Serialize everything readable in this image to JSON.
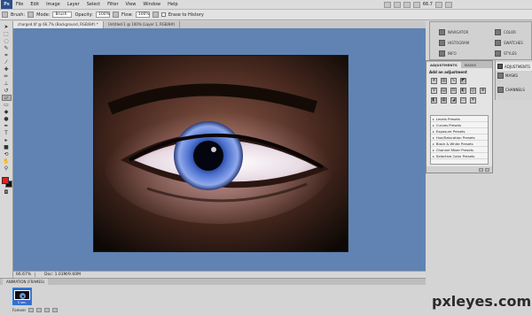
{
  "menubar": {
    "logo": "Ps",
    "items": [
      "File",
      "Edit",
      "Image",
      "Layer",
      "Select",
      "Filter",
      "View",
      "Window",
      "Help"
    ],
    "zoom": "66.7"
  },
  "options": {
    "brush_label": "Brush:",
    "mode_label": "Mode:",
    "mode_value": "Brush",
    "opacity_label": "Opacity:",
    "opacity_value": "100%",
    "flow_label": "Flow:",
    "flow_value": "100%",
    "erase_history_label": "Erase to History"
  },
  "doc_tabs": [
    "charged.tif @ 66.7% (Background, RGB/8#) *",
    "Untitled-1 @ 100% (Layer 1, RGB/8#)"
  ],
  "status": {
    "zoom": "66.67%",
    "doc": "Doc: 1.03M/9.60M"
  },
  "animation": {
    "title": "ANIMATION (FRAMES)",
    "frame_delay": "0 sec.",
    "loop": "Forever"
  },
  "dock_top": {
    "navigator": "NAVIGATOR",
    "histogram": "HISTOGRAM",
    "info": "INFO",
    "color": "COLOR",
    "swatches": "SWATCHES",
    "styles": "STYLES"
  },
  "dock_right": {
    "adjustments": "ADJUSTMENTS",
    "masks": "MASKS",
    "channels": "CHANNELS"
  },
  "adjustments_panel": {
    "tab_adjustments": "ADJUSTMENTS",
    "tab_masks": "MASKS",
    "add_label": "Add an adjustment",
    "presets": [
      "Levels Presets",
      "Curves Presets",
      "Exposure Presets",
      "Hue/Saturation Presets",
      "Black & White Presets",
      "Channel Mixer Presets",
      "Selective Color Presets"
    ]
  },
  "watermark": "pxleyes.com"
}
